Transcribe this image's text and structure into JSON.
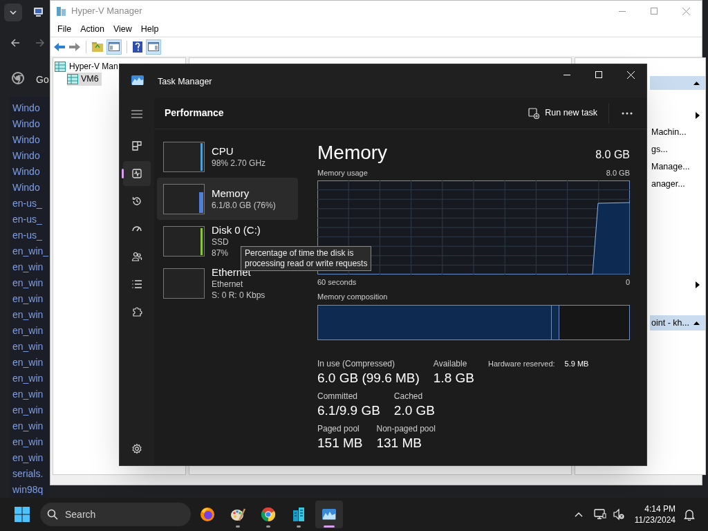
{
  "browser": {
    "tab_text": "Go",
    "files": [
      "Windo",
      "Windo",
      "Windo",
      "Windo",
      "Windo",
      "Windo",
      "en-us_",
      "en-us_",
      "en-us_",
      "en_win_",
      "en_win",
      "en_win",
      "en_win",
      "en_win",
      "en_win",
      "en_win",
      "en_win",
      "en_win",
      "en_win",
      "en_win",
      "en_win",
      "en_win",
      "en_win",
      "serials.",
      "win98q"
    ]
  },
  "hyperv": {
    "title": "Hyper-V Manager",
    "menu": [
      "File",
      "Action",
      "View",
      "Help"
    ],
    "tree": [
      {
        "label": "Hyper-V Man",
        "selected": false,
        "children": [
          {
            "label": "VM6",
            "selected": true
          }
        ]
      }
    ],
    "actions": {
      "items": [
        "Machin...",
        "gs...",
        "Manage...",
        "anager..."
      ],
      "section_title": "oint - kh..."
    }
  },
  "task_manager": {
    "title": "Task Manager",
    "page_title": "Performance",
    "run_new_task": "Run new task",
    "nav": [
      {
        "kind": "processes",
        "selected": false
      },
      {
        "kind": "performance",
        "selected": true
      },
      {
        "kind": "history",
        "selected": false
      },
      {
        "kind": "startup",
        "selected": false
      },
      {
        "kind": "users",
        "selected": false
      },
      {
        "kind": "details",
        "selected": false
      },
      {
        "kind": "services",
        "selected": false
      }
    ],
    "resources": [
      {
        "name": "CPU",
        "details": [
          "98% 2.70 GHz"
        ],
        "color": "#4f9fd8",
        "selected": false
      },
      {
        "name": "Memory",
        "details": [
          "6.1/8.0 GB (76%)"
        ],
        "color": "#4f7fd8",
        "selected": true
      },
      {
        "name": "Disk 0 (C:)",
        "details": [
          "SSD",
          "87%"
        ],
        "color": "#8cc63f",
        "selected": false
      },
      {
        "name": "Ethernet",
        "details": [
          "Ethernet",
          "S: 0 R: 0 Kbps"
        ],
        "selected": false
      }
    ],
    "tooltip": {
      "lines": [
        "Percentage of time the disk is",
        "processing read or write requests"
      ]
    },
    "detail": {
      "title": "Memory",
      "total": "8.0 GB",
      "usage_label": "Memory usage",
      "usage_max": "8.0 GB",
      "time_label": "60 seconds",
      "min_label": "0",
      "composition_label": "Memory composition",
      "composition": [
        {
          "kind": "in_use",
          "level": 0.75
        },
        {
          "kind": "modified"
        }
      ],
      "stat_rows": [
        [
          {
            "label": "In use (Compressed)",
            "value": "6.0 GB (99.6 MB)"
          },
          {
            "label": "Available",
            "value": "1.8 GB"
          }
        ],
        [
          {
            "label": "Committed",
            "value": "6.1/9.9 GB"
          },
          {
            "label": "Cached",
            "value": "2.0 GB"
          }
        ],
        [
          {
            "label": "Paged pool",
            "value": "151 MB"
          },
          {
            "label": "Non-paged pool",
            "value": "131 MB"
          }
        ]
      ],
      "hardware_reserved": {
        "label": "Hardware reserved:",
        "value": "5.9 MB"
      }
    }
  },
  "taskbar": {
    "search_placeholder": "Search",
    "apps": [
      {
        "kind": "firefox",
        "running": false,
        "active": false
      },
      {
        "kind": "paint",
        "running": true,
        "active": false
      },
      {
        "kind": "chrome",
        "running": true,
        "active": false
      },
      {
        "kind": "hyperv",
        "running": true,
        "active": false
      },
      {
        "kind": "taskmgr",
        "running": true,
        "active": true
      }
    ],
    "time": "4:14 PM",
    "date": "11/23/2024"
  }
}
